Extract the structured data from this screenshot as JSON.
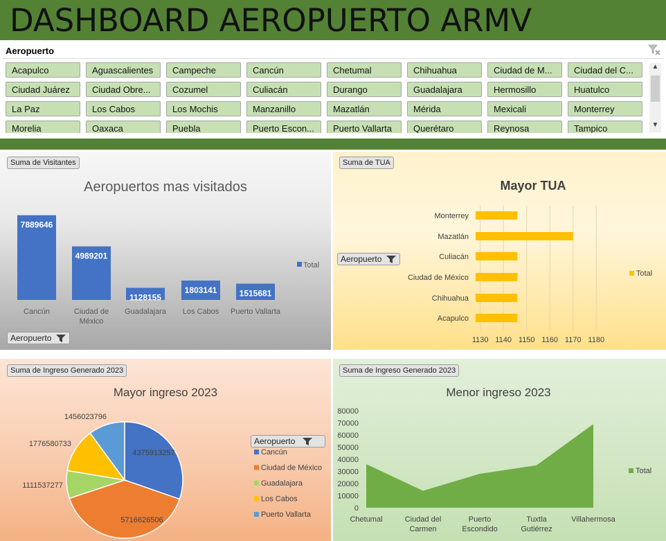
{
  "header": {
    "title": "DASHBOARD AEROPUERTO ARMV"
  },
  "slicer": {
    "title": "Aeropuerto",
    "items": [
      "Acapulco",
      "Aguascalientes",
      "Campeche",
      "Cancún",
      "Chetumal",
      "Chihuahua",
      "Ciudad de M...",
      "Ciudad del C...",
      "Ciudad Juárez",
      "Ciudad Obre...",
      "Cozumel",
      "Culiacán",
      "Durango",
      "Guadalajara",
      "Hermosillo",
      "Huatulco",
      "La Paz",
      "Los Cabos",
      "Los Mochis",
      "Manzanillo",
      "Mazatlán",
      "Mérida",
      "Mexicali",
      "Monterrey",
      "Morelia",
      "Oaxaca",
      "Puebla",
      "Puerto Escon...",
      "Puerto Vallarta",
      "Querétaro",
      "Reynosa",
      "Tampico"
    ]
  },
  "colors": {
    "band": "#548235",
    "chip": "#c6e0b4",
    "blue": "#4472c4",
    "gold": "#ffc000",
    "green": "#70ad47",
    "orange": "#ed7d31",
    "sky": "#5b9bd5"
  },
  "visitantes": {
    "field_button": "Suma de Visitantes",
    "filter_button": "Aeropuerto",
    "legend": "Total"
  },
  "tua": {
    "field_button": "Suma de TUA",
    "filter_button": "Aeropuerto",
    "legend": "Total"
  },
  "ingreso_mayor": {
    "field_button": "Suma de Ingreso Generado 2023",
    "legend_header": "Aeropuerto"
  },
  "ingreso_menor": {
    "field_button": "Suma de Ingreso Generado 2023",
    "legend": "Total"
  },
  "chart_data": [
    {
      "type": "bar",
      "title": "Aeropuertos mas visitados",
      "categories": [
        "Cancún",
        "Ciudad de México",
        "Guadalajara",
        "Los Cabos",
        "Puerto Vallarta"
      ],
      "category_lines": [
        [
          "Cancún"
        ],
        [
          "Ciudad de",
          "México"
        ],
        [
          "Guadalajara"
        ],
        [
          "Los Cabos"
        ],
        [
          "Puerto Vallarta"
        ]
      ],
      "series": [
        {
          "name": "Total",
          "values": [
            7889646,
            4989201,
            1128155,
            1803141,
            1515681
          ]
        }
      ],
      "color": "#4472c4",
      "ylim": [
        0,
        8000000
      ],
      "legend": "right"
    },
    {
      "type": "bar",
      "orientation": "horizontal",
      "title": "Mayor TUA",
      "categories": [
        "Monterrey",
        "Mazatlán",
        "Culiacán",
        "Ciudad de México",
        "Chihuahua",
        "Acapulco"
      ],
      "series": [
        {
          "name": "Total",
          "values": [
            1146,
            1170,
            1146,
            1146,
            1146,
            1146
          ]
        }
      ],
      "xticks": [
        1130,
        1140,
        1150,
        1160,
        1170,
        1180
      ],
      "xlim": [
        1128,
        1185
      ],
      "color": "#ffc000",
      "grid": true,
      "legend": "right"
    },
    {
      "type": "pie",
      "title": "Mayor ingreso 2023",
      "labels": [
        "Cancún",
        "Ciudad de México",
        "Guadalajara",
        "Los Cabos",
        "Puerto Vallarta"
      ],
      "values": [
        4375913257,
        5716626506,
        1111537277,
        1776580733,
        1456023796
      ],
      "colors": [
        "#4472c4",
        "#ed7d31",
        "#a5d565",
        "#ffc000",
        "#5b9bd5"
      ],
      "legend": "right"
    },
    {
      "type": "area",
      "title": "Menor ingreso 2023",
      "categories": [
        "Chetumal",
        "Ciudad del Carmen",
        "Puerto Escondido",
        "Tuxtla Gutiérrez",
        "Villahermosa"
      ],
      "category_lines": [
        [
          "Chetumal"
        ],
        [
          "Ciudad del",
          "Carmen"
        ],
        [
          "Puerto",
          "Escondido"
        ],
        [
          "Tuxtla",
          "Gutiérrez"
        ],
        [
          "Villahermosa"
        ]
      ],
      "series": [
        {
          "name": "Total",
          "values": [
            36000,
            14000,
            28000,
            35000,
            69000
          ]
        }
      ],
      "yticks": [
        0,
        10000,
        20000,
        30000,
        40000,
        50000,
        60000,
        70000,
        80000
      ],
      "ylim": [
        0,
        80000
      ],
      "color": "#70ad47",
      "legend": "right"
    }
  ]
}
